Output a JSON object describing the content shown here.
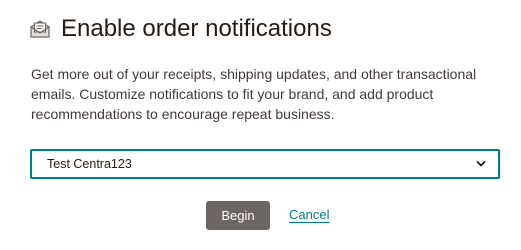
{
  "dialog": {
    "title": "Enable order notifications",
    "title_icon": "envelope-receipt-icon",
    "description": "Get more out of your receipts, shipping updates, and other transactional emails. Customize notifications to fit your brand, and add product recommendations to encourage repeat business."
  },
  "store_select": {
    "selected_value": "Test Centra123",
    "icon": "chevron-down-icon"
  },
  "actions": {
    "begin_label": "Begin",
    "cancel_label": "Cancel"
  },
  "colors": {
    "accent": "#007c89",
    "primary_button": "#6b6563",
    "text": "#241c15"
  }
}
